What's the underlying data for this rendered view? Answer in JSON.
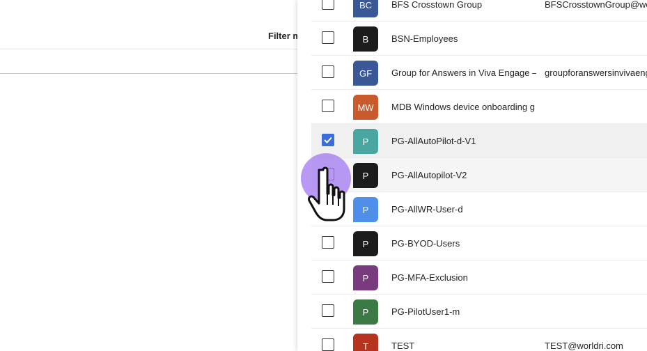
{
  "background": {
    "filter_label": "Filter m"
  },
  "groups": [
    {
      "initials": "BC",
      "name": "BFS Crosstown Group",
      "email": "BFSCrosstownGroup@wor",
      "color": "#3b5896",
      "checked": false
    },
    {
      "initials": "B",
      "name": "BSN-Employees",
      "email": "",
      "color": "#1c1c1c",
      "checked": false
    },
    {
      "initials": "GF",
      "name": "Group for Answers in Viva Engage –",
      "email": "groupforanswersinvivaeng",
      "color": "#3b5896",
      "checked": false
    },
    {
      "initials": "MW",
      "name": "MDB Windows device onboarding g",
      "email": "",
      "color": "#c85a2c",
      "checked": false
    },
    {
      "initials": "P",
      "name": "PG-AllAutoPilot-d-V1",
      "email": "",
      "color": "#4aa6a0",
      "checked": true
    },
    {
      "initials": "P",
      "name": "PG-AllAutopilot-V2",
      "email": "",
      "color": "#1c1c1c",
      "checked": false
    },
    {
      "initials": "P",
      "name": "PG-AllWR-User-d",
      "email": "",
      "color": "#4f8fea",
      "checked": false
    },
    {
      "initials": "P",
      "name": "PG-BYOD-Users",
      "email": "",
      "color": "#1c1c1c",
      "checked": false
    },
    {
      "initials": "P",
      "name": "PG-MFA-Exclusion",
      "email": "",
      "color": "#7a3a7e",
      "checked": false
    },
    {
      "initials": "P",
      "name": "PG-PilotUser1-m",
      "email": "",
      "color": "#3b7a45",
      "checked": false
    },
    {
      "initials": "T",
      "name": "TEST",
      "email": "TEST@worldri.com",
      "color": "#b6341e",
      "checked": false
    }
  ]
}
